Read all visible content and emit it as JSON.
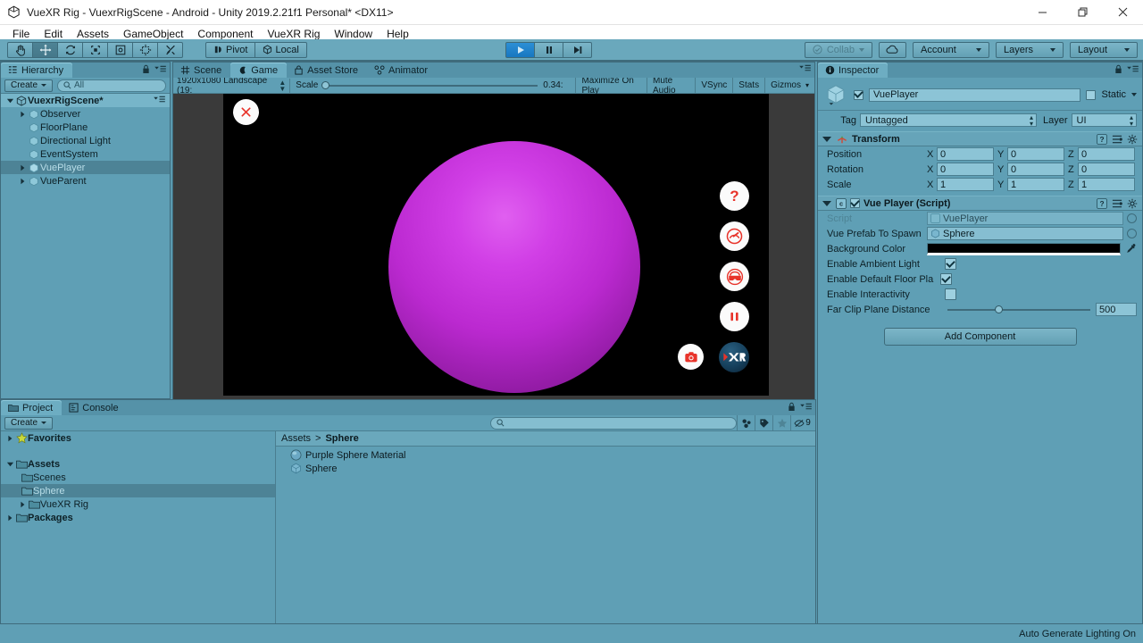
{
  "window": {
    "title": "VueXR Rig - VuexrRigScene - Android - Unity 2019.2.21f1 Personal* <DX11>",
    "minimize": "–",
    "maximize": "❐",
    "close": "✕"
  },
  "menubar": {
    "items": [
      "File",
      "Edit",
      "Assets",
      "GameObject",
      "Component",
      "VueXR Rig",
      "Window",
      "Help"
    ]
  },
  "toolbar": {
    "tools": [
      {
        "name": "hand-tool",
        "active": false
      },
      {
        "name": "move-tool",
        "active": true
      },
      {
        "name": "rotate-tool",
        "active": false
      },
      {
        "name": "scale-tool",
        "active": false
      },
      {
        "name": "rect-tool",
        "active": false
      },
      {
        "name": "transform-tool",
        "active": false
      },
      {
        "name": "custom-tool",
        "active": false
      }
    ],
    "pivot_label": "Pivot",
    "local_label": "Local",
    "play_label": "▶",
    "pause_label": "❚❚",
    "step_label": "▶|",
    "collab_label": "Collab",
    "cloud_label": "",
    "account_label": "Account",
    "layers_label": "Layers",
    "layout_label": "Layout"
  },
  "hierarchy": {
    "tab_label": "Hierarchy",
    "create_label": "Create",
    "search_placeholder": "All",
    "scene_name": "VuexrRigScene*",
    "items": [
      {
        "label": "Observer",
        "expandable": true,
        "selected": false,
        "indent": 2
      },
      {
        "label": "FloorPlane",
        "expandable": false,
        "selected": false,
        "indent": 2
      },
      {
        "label": "Directional Light",
        "expandable": false,
        "selected": false,
        "indent": 2
      },
      {
        "label": "EventSystem",
        "expandable": false,
        "selected": false,
        "indent": 2
      },
      {
        "label": "VuePlayer",
        "expandable": true,
        "selected": true,
        "indent": 2
      },
      {
        "label": "VueParent",
        "expandable": true,
        "selected": false,
        "indent": 2
      }
    ]
  },
  "gameview": {
    "tabs": [
      {
        "label": "Scene",
        "active": false,
        "icon": "grid-icon"
      },
      {
        "label": "Game",
        "active": true,
        "icon": "gamepad-icon"
      },
      {
        "label": "Asset Store",
        "active": false,
        "icon": "store-icon"
      },
      {
        "label": "Animator",
        "active": false,
        "icon": "animator-icon"
      }
    ],
    "aspect": "1920x1080 Landscape (19:",
    "scale_label": "Scale",
    "scale_value": "0.34:",
    "maximize_label": "Maximize On Play",
    "mute_label": "Mute Audio",
    "vsync_label": "VSync",
    "stats_label": "Stats",
    "gizmos_label": "Gizmos",
    "overlay_buttons": [
      {
        "name": "close-overlay-button",
        "glyph": "✕"
      },
      {
        "name": "help-button",
        "glyph": "?"
      },
      {
        "name": "performance-button",
        "glyph": "speedometer"
      },
      {
        "name": "headset-button",
        "glyph": "vr-headset"
      },
      {
        "name": "pause-button",
        "glyph": "❚❚"
      },
      {
        "name": "screenshot-button",
        "glyph": "camera"
      },
      {
        "name": "xr-logo-button",
        "glyph": "XR"
      }
    ],
    "accent_red": "#e8332a",
    "xr_blue": "#17415d"
  },
  "inspector": {
    "tab_label": "Inspector",
    "object_name": "VuePlayer",
    "static_label": "Static",
    "tag_label": "Tag",
    "tag_value": "Untagged",
    "layer_label": "Layer",
    "layer_value": "UI",
    "transform": {
      "title": "Transform",
      "rows": [
        {
          "label": "Position",
          "x": "0",
          "y": "0",
          "z": "0"
        },
        {
          "label": "Rotation",
          "x": "0",
          "y": "0",
          "z": "0"
        },
        {
          "label": "Scale",
          "x": "1",
          "y": "1",
          "z": "1"
        }
      ],
      "axes": [
        "X",
        "Y",
        "Z"
      ]
    },
    "script_component": {
      "title": "Vue Player (Script)",
      "script_label": "Script",
      "script_value": "VuePlayer",
      "prefab_label": "Vue Prefab To Spawn",
      "prefab_value": "Sphere",
      "bgcolor_label": "Background Color",
      "bgcolor_value": "#000000",
      "ambient_label": "Enable Ambient Light",
      "ambient_checked": true,
      "floor_label": "Enable Default Floor Pla",
      "floor_checked": true,
      "interactivity_label": "Enable Interactivity",
      "interactivity_checked": false,
      "farclip_label": "Far Clip Plane Distance",
      "farclip_value": "500"
    },
    "add_component_label": "Add Component"
  },
  "project": {
    "tabs": [
      {
        "label": "Project",
        "active": true
      },
      {
        "label": "Console",
        "active": false
      }
    ],
    "create_label": "Create",
    "search_placeholder": "",
    "filter_count": "9",
    "tree": [
      {
        "label": "Favorites",
        "bold": true,
        "expandable": true,
        "indent": 0,
        "icon": "star-icon",
        "selected": false
      },
      {
        "label": "",
        "bold": false,
        "expandable": false,
        "indent": 0,
        "icon": "none",
        "selected": false
      },
      {
        "label": "Assets",
        "bold": true,
        "expandable": true,
        "expanded": true,
        "indent": 0,
        "icon": "folder-icon",
        "selected": false
      },
      {
        "label": "Scenes",
        "bold": false,
        "expandable": false,
        "indent": 1,
        "icon": "folder-icon",
        "selected": false
      },
      {
        "label": "Sphere",
        "bold": false,
        "expandable": false,
        "indent": 1,
        "icon": "folder-icon",
        "selected": true
      },
      {
        "label": "VueXR Rig",
        "bold": false,
        "expandable": true,
        "indent": 1,
        "icon": "folder-icon",
        "selected": false
      },
      {
        "label": "Packages",
        "bold": true,
        "expandable": true,
        "indent": 0,
        "icon": "folder-icon",
        "selected": false
      }
    ],
    "breadcrumb": [
      "Assets",
      "Sphere"
    ],
    "assets": [
      {
        "label": "Purple Sphere Material",
        "icon": "material-icon"
      },
      {
        "label": "Sphere",
        "icon": "prefab-icon"
      }
    ]
  },
  "statusbar": {
    "message": "Auto Generate Lighting On"
  }
}
